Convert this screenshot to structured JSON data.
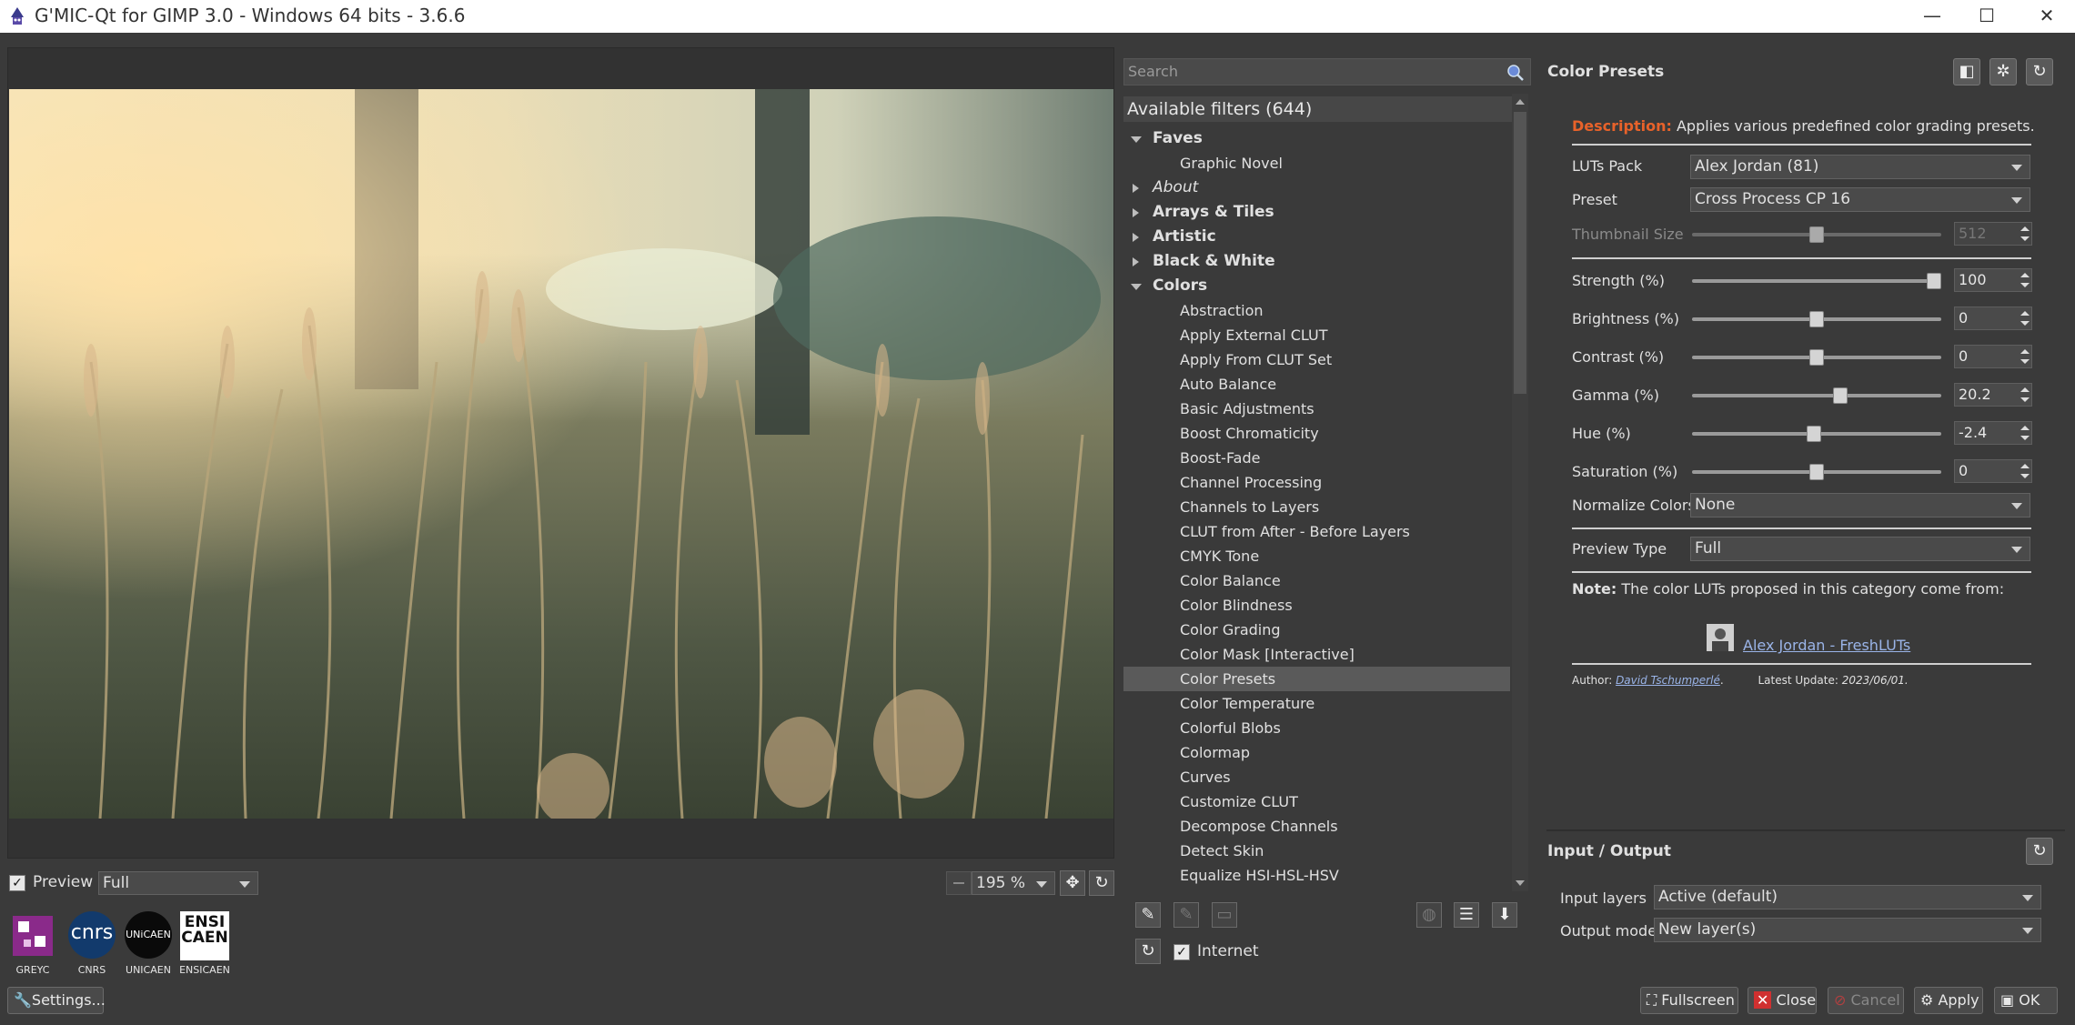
{
  "window": {
    "title": "G'MIC-Qt for GIMP 3.0 - Windows 64 bits - 3.6.6",
    "minimize": "—",
    "maximize": "☐",
    "close": "✕"
  },
  "preview": {
    "checkbox_label": "Preview",
    "checkbox_checked": true,
    "mode": "Full",
    "zoom": "195 %",
    "logos": [
      {
        "label": "GREYC"
      },
      {
        "label": "CNRS",
        "text": "cnrs"
      },
      {
        "label": "UNICAEN",
        "text": "UNiCAEN"
      },
      {
        "label": "ENSICAEN",
        "text": "ENSI CAEN"
      }
    ],
    "settings_button": "Settings..."
  },
  "filters": {
    "search_placeholder": "Search",
    "header": "Available filters (644)",
    "items": [
      {
        "label": "Faves",
        "type": "cat",
        "open": true
      },
      {
        "label": "Graphic Novel",
        "type": "item"
      },
      {
        "label": "About",
        "type": "cat-italic",
        "open": false
      },
      {
        "label": "Arrays & Tiles",
        "type": "cat",
        "open": false
      },
      {
        "label": "Artistic",
        "type": "cat",
        "open": false
      },
      {
        "label": "Black & White",
        "type": "cat",
        "open": false
      },
      {
        "label": "Colors",
        "type": "cat",
        "open": true
      },
      {
        "label": "Abstraction",
        "type": "item"
      },
      {
        "label": "Apply External CLUT",
        "type": "item"
      },
      {
        "label": "Apply From CLUT Set",
        "type": "item"
      },
      {
        "label": "Auto Balance",
        "type": "item"
      },
      {
        "label": "Basic Adjustments",
        "type": "item"
      },
      {
        "label": "Boost Chromaticity",
        "type": "item"
      },
      {
        "label": "Boost-Fade",
        "type": "item"
      },
      {
        "label": "Channel Processing",
        "type": "item"
      },
      {
        "label": "Channels to Layers",
        "type": "item"
      },
      {
        "label": "CLUT from After - Before Layers",
        "type": "item"
      },
      {
        "label": "CMYK Tone",
        "type": "item"
      },
      {
        "label": "Color Balance",
        "type": "item"
      },
      {
        "label": "Color Blindness",
        "type": "item"
      },
      {
        "label": "Color Grading",
        "type": "item"
      },
      {
        "label": "Color Mask [Interactive]",
        "type": "item"
      },
      {
        "label": "Color Presets",
        "type": "item",
        "selected": true
      },
      {
        "label": "Color Temperature",
        "type": "item"
      },
      {
        "label": "Colorful Blobs",
        "type": "item"
      },
      {
        "label": "Colormap",
        "type": "item"
      },
      {
        "label": "Curves",
        "type": "item"
      },
      {
        "label": "Customize CLUT",
        "type": "item"
      },
      {
        "label": "Decompose Channels",
        "type": "item"
      },
      {
        "label": "Detect Skin",
        "type": "item"
      },
      {
        "label": "Equalize HSI-HSL-HSV",
        "type": "item"
      }
    ],
    "internet_label": "Internet",
    "internet_checked": true
  },
  "panel": {
    "title": "Color Presets",
    "description_label": "Description:",
    "description_text": "Applies various predefined color grading presets.",
    "luts_pack_label": "LUTs Pack",
    "luts_pack_value": "Alex Jordan (81)",
    "preset_label": "Preset",
    "preset_value": "Cross Process CP 16",
    "thumbnail_label": "Thumbnail Size",
    "thumbnail_value": "512",
    "thumbnail_level": 0.5,
    "params": [
      {
        "label": "Strength (%)",
        "value": "100",
        "level": 1.0
      },
      {
        "label": "Brightness (%)",
        "value": "0",
        "level": 0.5
      },
      {
        "label": "Contrast (%)",
        "value": "0",
        "level": 0.5
      },
      {
        "label": "Gamma (%)",
        "value": "20.2",
        "level": 0.6
      },
      {
        "label": "Hue (%)",
        "value": "-2.4",
        "level": 0.488
      },
      {
        "label": "Saturation (%)",
        "value": "0",
        "level": 0.5
      }
    ],
    "normalize_label": "Normalize Colors",
    "normalize_value": "None",
    "preview_type_label": "Preview Type",
    "preview_type_value": "Full",
    "note_label": "Note:",
    "note_text": "The color LUTs proposed in this category come from:",
    "link_text": "Alex Jordan - FreshLUTs",
    "author_label": "Author:",
    "author_name": "David Tschumperlé",
    "author_dot": ".",
    "update_label": "Latest Update:",
    "update_value": "2023/06/01."
  },
  "io": {
    "title": "Input / Output",
    "input_label": "Input layers",
    "input_value": "Active (default)",
    "output_label": "Output mode",
    "output_value": "New layer(s)"
  },
  "buttons": {
    "fullscreen": "Fullscreen",
    "close": "Close",
    "cancel": "Cancel",
    "apply": "Apply",
    "ok": "OK"
  },
  "colors": {
    "accent_description": "#e8622a",
    "link": "#9ab4e8",
    "selected_row": "#5a5a5a"
  }
}
